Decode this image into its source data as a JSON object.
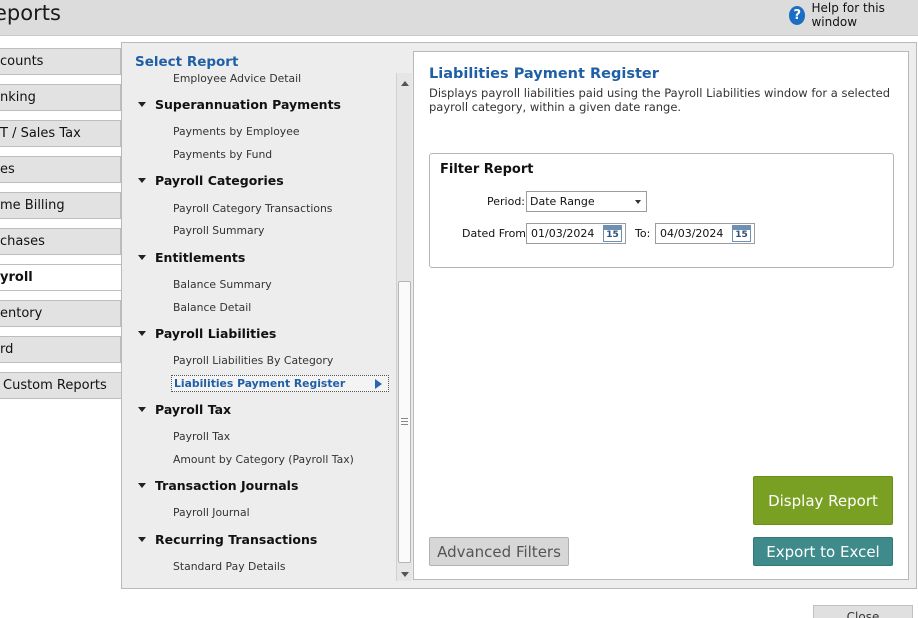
{
  "window": {
    "title": "eports"
  },
  "help": {
    "label": "Help for this window"
  },
  "tabs": [
    {
      "label": "counts"
    },
    {
      "label": "nking"
    },
    {
      "label": "T / Sales Tax"
    },
    {
      "label": "es"
    },
    {
      "label": "me Billing"
    },
    {
      "label": "chases"
    },
    {
      "label": "yroll"
    },
    {
      "label": "entory"
    },
    {
      "label": "rd"
    },
    {
      "label": "Custom Reports"
    }
  ],
  "report_list": {
    "heading": "Select Report",
    "top_item": "Employee Advice Detail",
    "categories": [
      {
        "name": "Superannuation Payments",
        "items": [
          "Payments by Employee",
          "Payments by Fund"
        ]
      },
      {
        "name": "Payroll Categories",
        "items": [
          "Payroll Category Transactions",
          "Payroll Summary"
        ]
      },
      {
        "name": "Entitlements",
        "items": [
          "Balance Summary",
          "Balance Detail"
        ]
      },
      {
        "name": "Payroll Liabilities",
        "items": [
          "Payroll Liabilities By Category",
          "Liabilities Payment Register"
        ]
      },
      {
        "name": "Payroll Tax",
        "items": [
          "Payroll Tax",
          "Amount by Category (Payroll Tax)"
        ]
      },
      {
        "name": "Transaction Journals",
        "items": [
          "Payroll Journal"
        ]
      },
      {
        "name": "Recurring Transactions",
        "items": [
          "Standard Pay Details"
        ]
      }
    ]
  },
  "detail": {
    "title": "Liabilities Payment Register",
    "description": "Displays payroll liabilities paid using the Payroll Liabilities window for a selected payroll category, within a given date range."
  },
  "filter": {
    "title": "Filter Report",
    "period_label": "Period:",
    "period_value": "Date Range",
    "dated_from_label": "Dated From:",
    "dated_from_value": "01/03/2024",
    "to_label": "To:",
    "to_value": "04/03/2024",
    "calendar_day": "15"
  },
  "buttons": {
    "display_report": "Display Report",
    "export_excel": "Export to Excel",
    "advanced_filters": "Advanced Filters",
    "close": "Close"
  },
  "icons": {
    "help": "question-circle-icon",
    "calendar": "calendar-icon",
    "expand": "triangle-down-icon"
  },
  "colors": {
    "accent_blue": "#1f5fa6",
    "display_green": "#7aa023",
    "excel_teal": "#3f8a8a"
  }
}
